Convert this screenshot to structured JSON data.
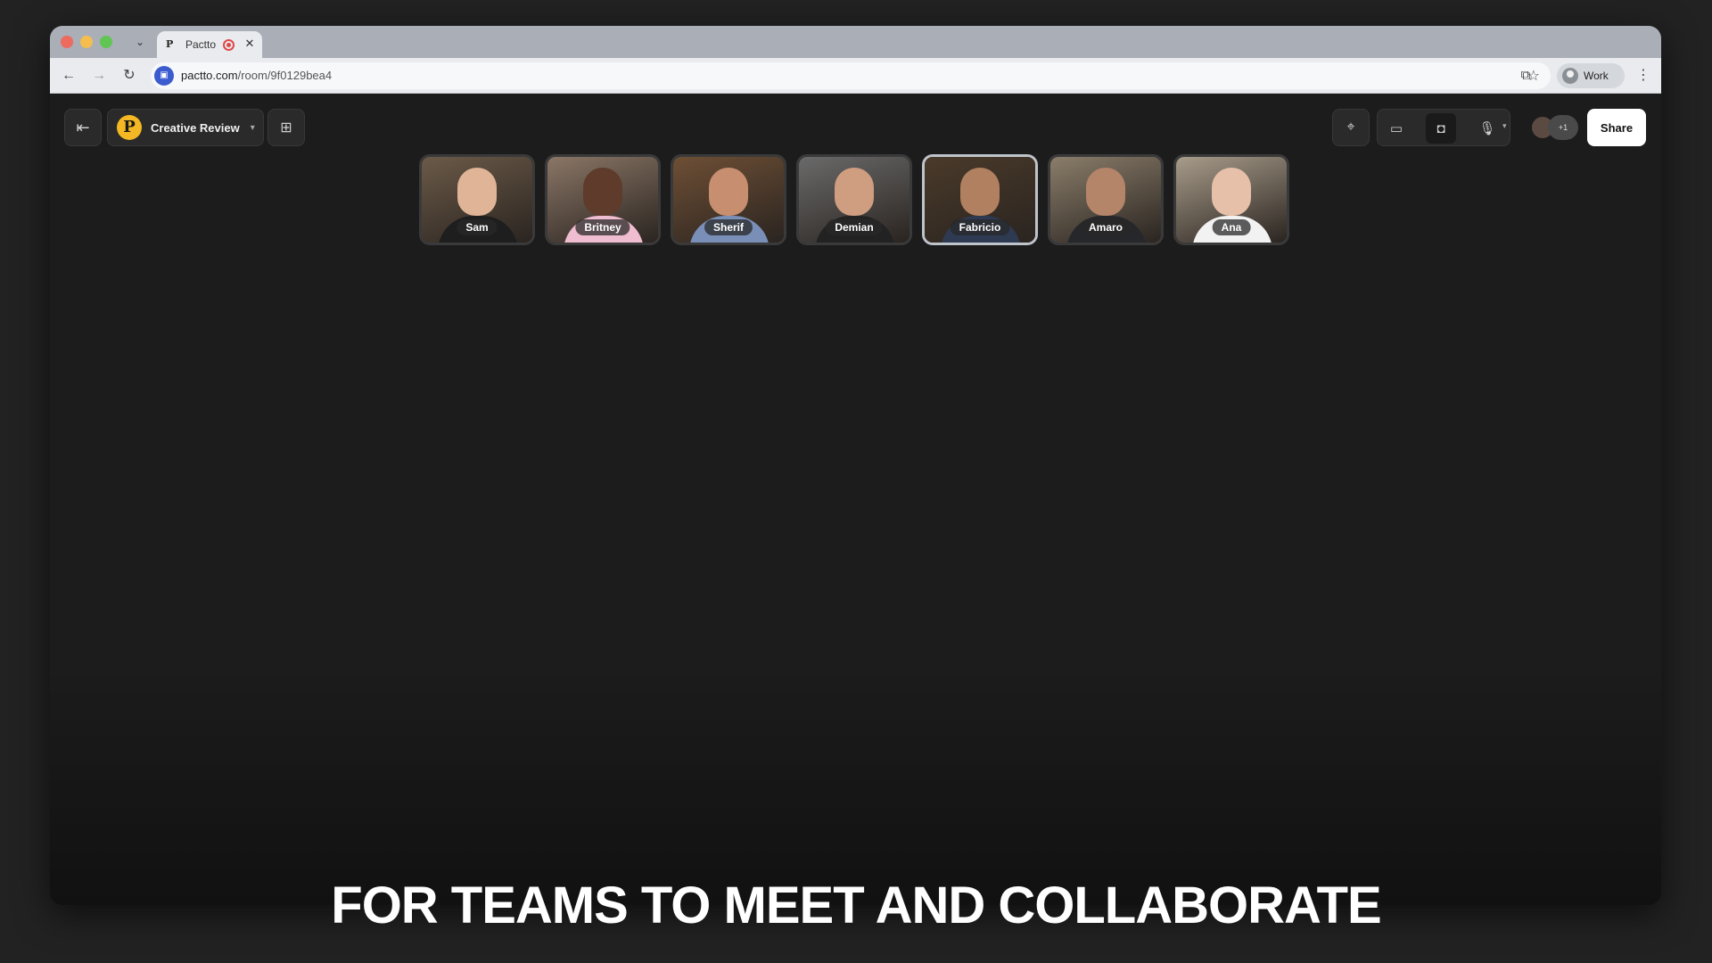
{
  "browser": {
    "tab_title": "Pactto",
    "tab_favicon": "P",
    "url_host": "pactto.com",
    "url_path": "/room/9f0129bea4",
    "profile_label": "Work"
  },
  "app": {
    "room_name": "Creative Review",
    "room_logo_letter": "P",
    "share_label": "Share",
    "participants_more": "+1",
    "brand_color": "#f3b823"
  },
  "participants": [
    {
      "name": "Sam",
      "bg": "#6b5a48",
      "skin": "#e0b497",
      "shirt": "#1e1e1e",
      "active": false
    },
    {
      "name": "Britney",
      "bg": "#8a7666",
      "skin": "#5e3b2a",
      "shirt": "#f0bcd0",
      "active": false
    },
    {
      "name": "Sherif",
      "bg": "#6e4f35",
      "skin": "#c78f70",
      "shirt": "#7a8fb8",
      "active": false
    },
    {
      "name": "Demian",
      "bg": "#6a6a6a",
      "skin": "#cf9d80",
      "shirt": "#222222",
      "active": false
    },
    {
      "name": "Fabricio",
      "bg": "#4a3a2a",
      "skin": "#b08060",
      "shirt": "#2e3a52",
      "active": true
    },
    {
      "name": "Amaro",
      "bg": "#8a7d6a",
      "skin": "#b5856a",
      "shirt": "#26272b",
      "active": false
    },
    {
      "name": "Ana",
      "bg": "#a89c8a",
      "skin": "#e6c0a8",
      "shirt": "#f2f2f2",
      "active": false
    }
  ],
  "caption": "FOR TEAMS TO MEET AND COLLABORATE"
}
